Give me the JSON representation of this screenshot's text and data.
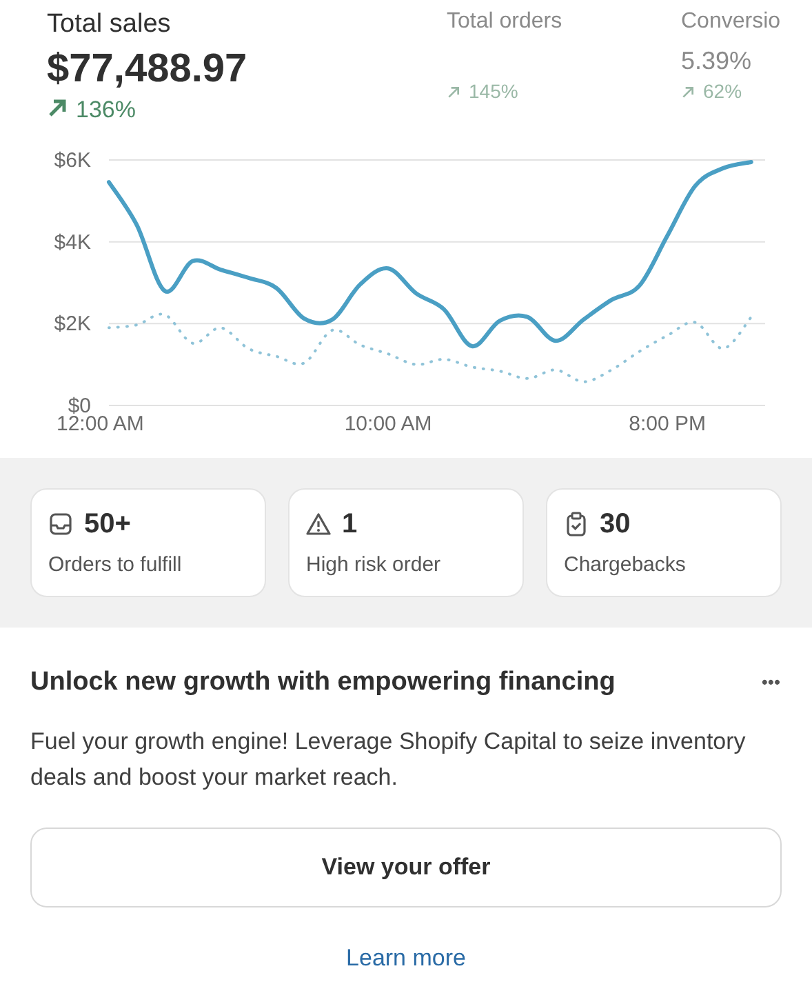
{
  "metrics": [
    {
      "title": "Total sales",
      "value": "$77,488.97",
      "change": "136%",
      "kind": "primary"
    },
    {
      "title": "Total orders",
      "change": "145%",
      "kind": "secondary"
    },
    {
      "title": "Conversio",
      "value": "5.39%",
      "change": "62%",
      "kind": "secondary"
    }
  ],
  "chart_data": {
    "type": "line",
    "x": [
      0,
      1,
      2,
      3,
      4,
      5,
      6,
      7,
      8,
      9,
      10,
      11,
      12,
      13,
      14,
      15,
      16,
      17,
      18,
      19,
      20,
      21,
      22,
      23
    ],
    "ylim": [
      0,
      6000
    ],
    "xlim": [
      0,
      23.5
    ],
    "yticks": [
      {
        "value": 0,
        "label": "$0"
      },
      {
        "value": 2000,
        "label": "$2K"
      },
      {
        "value": 4000,
        "label": "$4K"
      },
      {
        "value": 6000,
        "label": "$6K"
      }
    ],
    "xticks": [
      {
        "value": 0,
        "label": "12:00 AM"
      },
      {
        "value": 10,
        "label": "10:00 AM"
      },
      {
        "value": 20,
        "label": "8:00 PM"
      }
    ],
    "series": [
      {
        "color": "#4a9fc4",
        "line_style": "solid",
        "values": [
          5460,
          4410,
          2800,
          3530,
          3320,
          3120,
          2870,
          2120,
          2100,
          2960,
          3350,
          2740,
          2350,
          1450,
          2070,
          2160,
          1580,
          2100,
          2580,
          2930,
          4150,
          5370,
          5800,
          5950
        ]
      },
      {
        "color": "#8fc3d8",
        "line_style": "dotted",
        "values": [
          1900,
          1970,
          2220,
          1520,
          1900,
          1390,
          1200,
          1040,
          1840,
          1480,
          1260,
          1000,
          1130,
          940,
          840,
          660,
          870,
          580,
          870,
          1320,
          1710,
          2030,
          1390,
          2160
        ]
      }
    ]
  },
  "stats": [
    {
      "kind": "orders",
      "value": "50+",
      "label": "Orders to fulfill"
    },
    {
      "kind": "risk",
      "value": "1",
      "label": "High risk order"
    },
    {
      "kind": "chargebacks",
      "value": "30",
      "label": "Chargebacks"
    }
  ],
  "promo": {
    "title": "Unlock new growth with empowering financing",
    "menu": "•••",
    "text": "Fuel your growth engine! Leverage Shopify Capital to seize inventory deals and boost your market reach.",
    "button": "View your offer",
    "link": "Learn more"
  }
}
